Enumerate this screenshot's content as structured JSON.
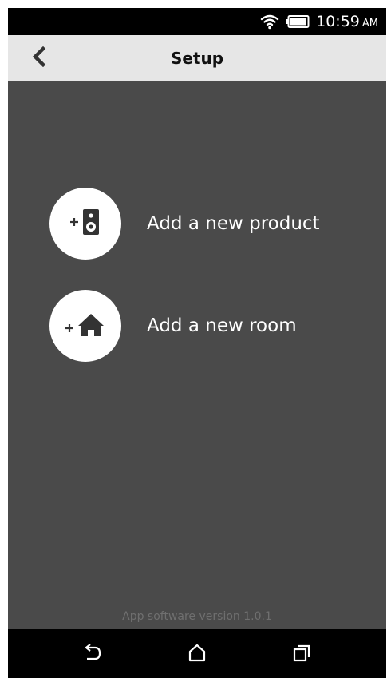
{
  "status_bar": {
    "time": "10:59",
    "ampm": "AM",
    "icons": [
      "wifi-icon",
      "battery-icon"
    ]
  },
  "app_bar": {
    "title": "Setup",
    "back_icon": "chevron-left-icon"
  },
  "actions": [
    {
      "label": "Add a new product",
      "icon": "add-speaker-icon"
    },
    {
      "label": "Add a new room",
      "icon": "add-room-icon"
    }
  ],
  "footer": {
    "version_text": "App software version 1.0.1"
  },
  "nav_bar": {
    "icons": [
      "back-icon",
      "home-icon",
      "recent-apps-icon"
    ]
  },
  "colors": {
    "content_bg": "#4a4a4a",
    "app_bar_bg": "#e6e6e6",
    "circle_bg": "#ffffff",
    "text_light": "#ffffff",
    "version_text": "#6f6f6f"
  }
}
